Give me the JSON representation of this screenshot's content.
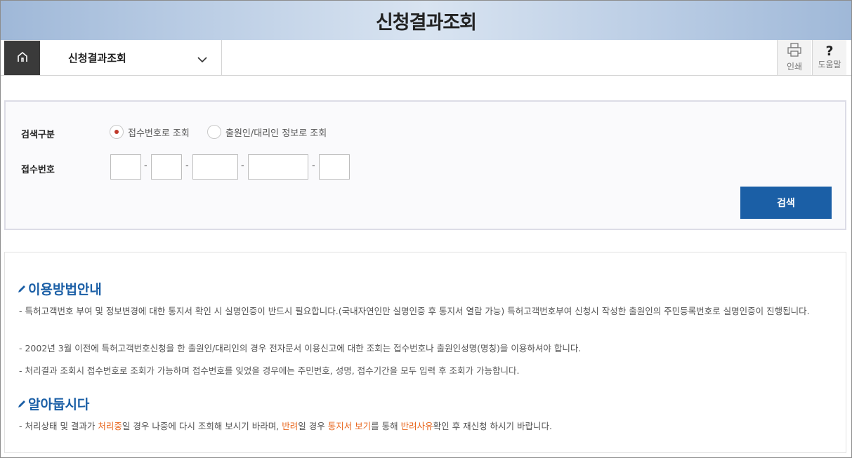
{
  "page": {
    "title": "신청결과조회"
  },
  "nav": {
    "home_icon": "home-icon",
    "current_menu": "신청결과조회",
    "chevron_icon": "chevron-down-icon",
    "print_label": "인쇄",
    "print_icon": "printer-icon",
    "help_label": "도움말",
    "help_icon": "question-mark-icon",
    "help_glyph": "?"
  },
  "search": {
    "type_label": "검색구분",
    "options": [
      {
        "label": "접수번호로 조회",
        "selected": true
      },
      {
        "label": "출원인/대리인 정보로 조회",
        "selected": false
      }
    ],
    "number_label": "접수번호",
    "number_parts": [
      "",
      "",
      "",
      "",
      ""
    ],
    "separator": "-",
    "button_label": "검색",
    "accent_color": "#1b5fa6"
  },
  "guide": {
    "title": "이용방법안내",
    "items": [
      "- 특허고객번호 부여 및 정보변경에 대한 통지서 확인 시 실명인증이 반드시 필요합니다.(국내자연인만 실명인증 후 통지서 열람 가능) 특허고객번호부여 신청시 작성한 출원인의 주민등록번호로 실명인증이 진행됩니다.",
      "- 2002년 3월 이전에 특허고객번호신청을 한 출원인/대리인의 경우 전자문서 이용신고에 대한 조회는 접수번호나 출원인성명(명칭)을 이용하셔야 합니다.",
      "- 처리결과 조회시 접수번호로 조회가 가능하며 접수번호를 잊었을 경우에는 주민번호, 성명, 접수기간을 모두 입력 후 조회가 가능합니다."
    ]
  },
  "notice": {
    "title": "알아둡시다",
    "segments": [
      {
        "text": "- 처리상태 및 결과가 ",
        "highlight": false
      },
      {
        "text": "처리중",
        "highlight": true
      },
      {
        "text": "일 경우 나중에 다시 조회해 보시기 바라며, ",
        "highlight": false
      },
      {
        "text": "반려",
        "highlight": true
      },
      {
        "text": "일 경우 ",
        "highlight": false
      },
      {
        "text": "통지서 보기",
        "highlight": true
      },
      {
        "text": "를 통해 ",
        "highlight": false
      },
      {
        "text": "반려사유",
        "highlight": true
      },
      {
        "text": "확인 후 재신청 하시기 바랍니다.",
        "highlight": false
      }
    ],
    "highlight_color": "#e8671e"
  }
}
